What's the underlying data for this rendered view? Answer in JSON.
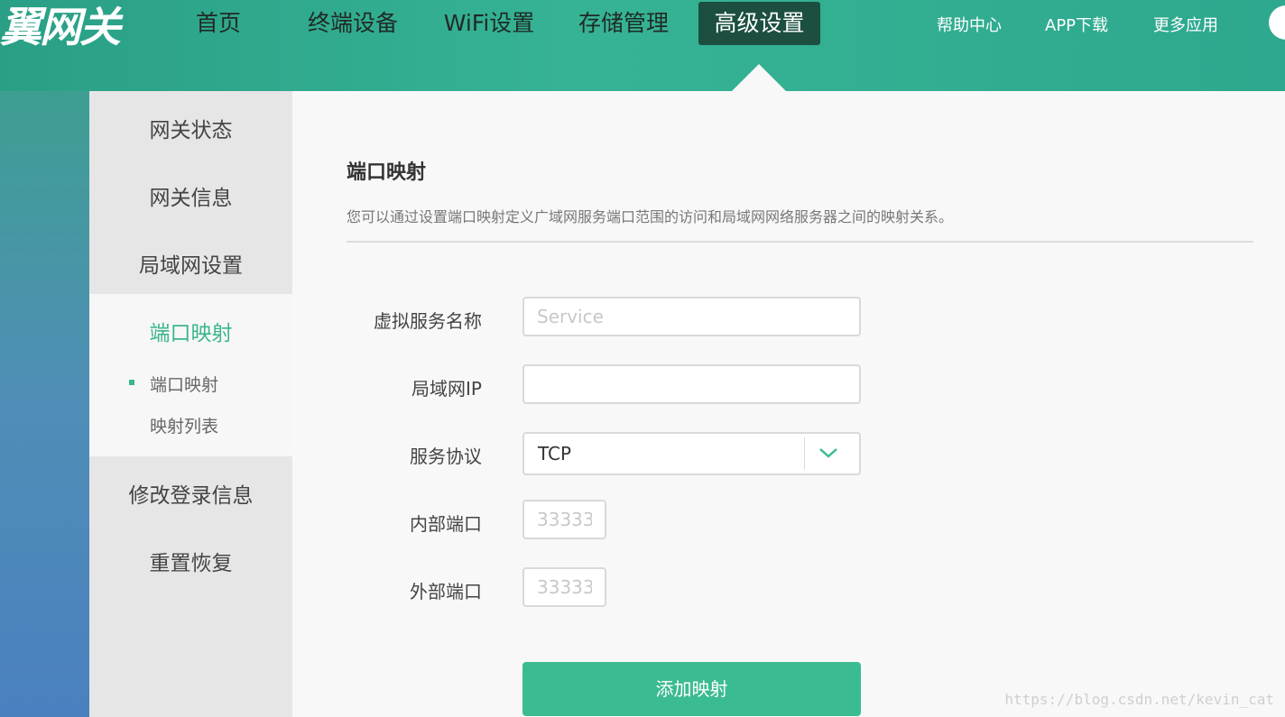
{
  "header": {
    "logo": "翼网关",
    "nav": [
      {
        "label": "首页",
        "active": false
      },
      {
        "label": "终端设备",
        "active": false
      },
      {
        "label": "WiFi设置",
        "active": false
      },
      {
        "label": "存储管理",
        "active": false
      },
      {
        "label": "高级设置",
        "active": true
      }
    ],
    "links": [
      "帮助中心",
      "APP下载",
      "更多应用"
    ]
  },
  "sidebar": {
    "items": [
      "网关状态",
      "网关信息",
      "局域网设置",
      "端口映射",
      "修改登录信息",
      "重置恢复"
    ],
    "active_item": "端口映射",
    "sub_items": [
      "端口映射",
      "映射列表"
    ],
    "active_sub_item": "端口映射"
  },
  "main": {
    "title": "端口映射",
    "description": "您可以通过设置端口映射定义广域网服务端口范围的访问和局域网网络服务器之间的映射关系。",
    "form": {
      "service_name_label": "虚拟服务名称",
      "service_name_placeholder": "Service",
      "service_name_value": "",
      "lan_ip_label": "局域网IP",
      "lan_ip_value": "",
      "protocol_label": "服务协议",
      "protocol_value": "TCP",
      "internal_port_label": "内部端口",
      "internal_port_placeholder": "33333",
      "external_port_label": "外部端口",
      "external_port_placeholder": "33333",
      "submit_label": "添加映射"
    }
  },
  "watermark": "https://blog.csdn.net/kevin_cat",
  "colors": {
    "accent": "#3bbb92",
    "nav_active_bg": "#1c4f40",
    "header_bg": "#36b394"
  }
}
